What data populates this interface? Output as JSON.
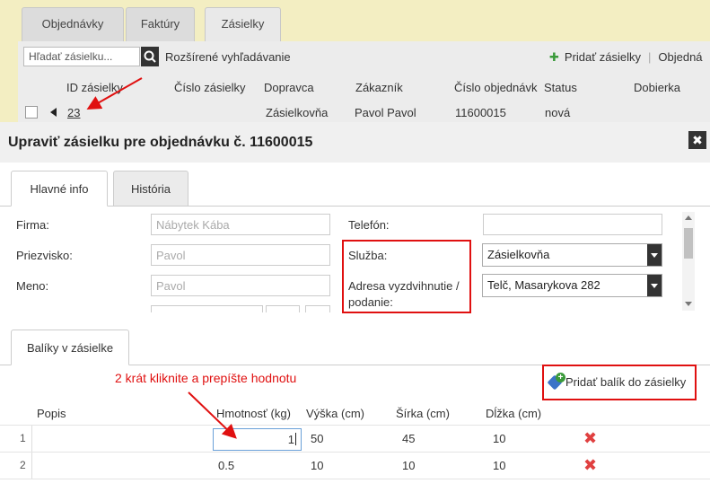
{
  "background": {
    "tabs": [
      "Objednávky",
      "Faktúry",
      "Zásielky"
    ],
    "search_placeholder": "Hľadať zásielku...",
    "advanced_search": "Rozšírené vyhľadávanie",
    "add_shipments": "Pridať zásielky",
    "orders_cut": "Objedná",
    "headers": [
      "ID zásielky",
      "Číslo zásielky",
      "Dopravca",
      "Zákazník",
      "Číslo objednávk",
      "Status",
      "Dobierka"
    ],
    "row": {
      "id": "23",
      "carrier": "Zásielkovňa",
      "customer": "Pavol Pavol",
      "order_number": "11600015",
      "status": "nová"
    }
  },
  "modal": {
    "title": "Upraviť zásielku pre objednávku č. 11600015",
    "close_glyph": "✖",
    "tabs": [
      "Hlavné info",
      "História"
    ],
    "form": {
      "firma_label": "Firma:",
      "firma_value": "Nábytek Kába",
      "priezvisko_label": "Priezvisko:",
      "priezvisko_value": "Pavol",
      "meno_label": "Meno:",
      "meno_value": "Pavol",
      "telefon_label": "Telefón:",
      "telefon_value": "",
      "sluzba_label": "Služba:",
      "sluzba_value": "Zásielkovňa",
      "adresa_label": "Adresa vyzdvihnutie / podanie:",
      "adresa_value": "Telč, Masarykova 282"
    },
    "packages_tab": "Balíky v zásielke",
    "annotation": "2 krát kliknite a prepíšte hodnotu",
    "add_package": "Pridať balík do zásielky",
    "grid": {
      "headers": [
        "Popis",
        "Hmotnosť (kg)",
        "Výška (cm)",
        "Šírka (cm)",
        "Dĺžka (cm)"
      ],
      "rows": [
        {
          "num": "1",
          "popis": "",
          "weight": "1",
          "height": "50",
          "width": "45",
          "length": "10"
        },
        {
          "num": "2",
          "popis": "",
          "weight": "0.5",
          "height": "10",
          "width": "10",
          "length": "10"
        }
      ],
      "delete_glyph": "✖"
    }
  },
  "colors": {
    "annotation_red": "#e01010",
    "background_yellow": "#f3eec2",
    "delete_red": "#e04040",
    "add_green": "#3a9a3a"
  }
}
